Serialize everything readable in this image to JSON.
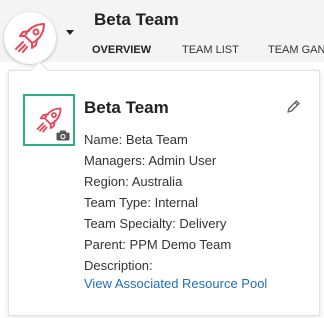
{
  "header": {
    "team_name": "Beta Team",
    "tabs": [
      {
        "label": "OVERVIEW",
        "active": true
      },
      {
        "label": "TEAM LIST",
        "active": false
      },
      {
        "label": "TEAM GAN",
        "active": false
      }
    ]
  },
  "card": {
    "title": "Beta Team",
    "fields": [
      {
        "label": "Name:",
        "value": "Beta Team"
      },
      {
        "label": "Managers:",
        "value": "Admin User"
      },
      {
        "label": "Region:",
        "value": "Australia"
      },
      {
        "label": "Team Type:",
        "value": "Internal"
      },
      {
        "label": "Team Specialty:",
        "value": "Delivery"
      },
      {
        "label": "Parent:",
        "value": "PPM Demo Team"
      },
      {
        "label": "Description:",
        "value": ""
      }
    ],
    "link_text": "View Associated Resource Pool"
  },
  "icons": {
    "team_logo": "rocket-icon",
    "camera": "camera-icon",
    "edit": "pencil-icon",
    "dropdown": "caret-down-icon"
  },
  "colors": {
    "accent_red": "#e8475b",
    "highlight_green": "#2fae8a",
    "link_blue": "#1f6fb8"
  }
}
